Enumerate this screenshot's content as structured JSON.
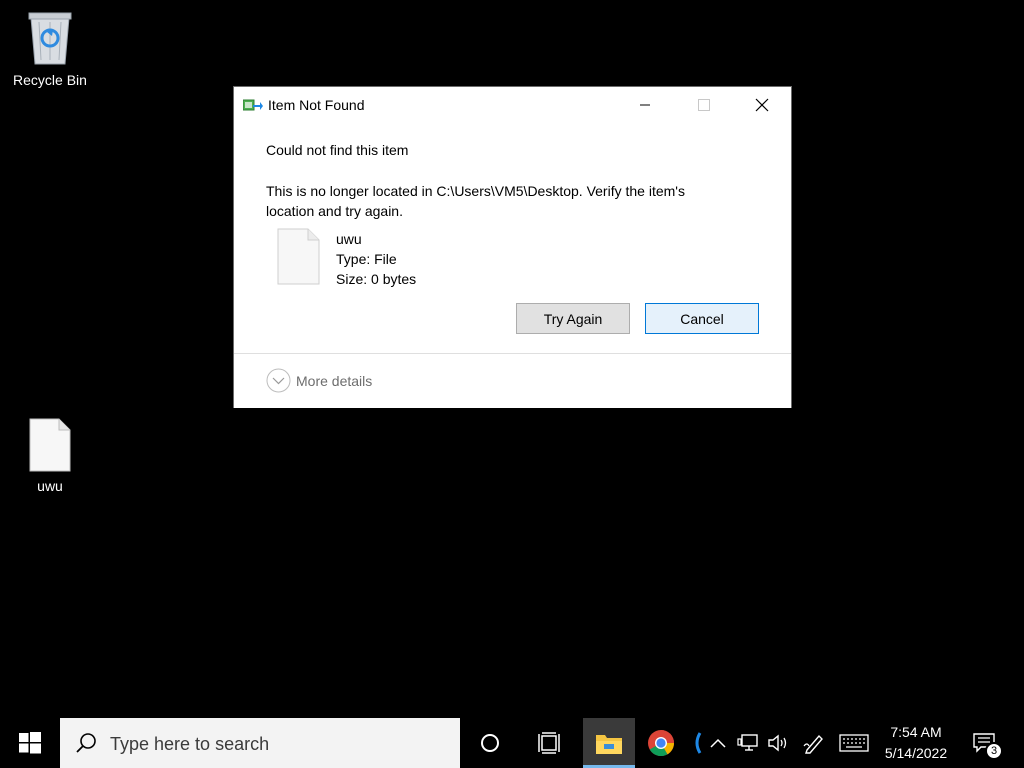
{
  "desktop": {
    "icons": [
      {
        "label": "Recycle Bin"
      },
      {
        "label": "uwu"
      }
    ]
  },
  "dialog": {
    "title": "Item Not Found",
    "heading": "Could not find this item",
    "message": "This is no longer located in C:\\Users\\VM5\\Desktop. Verify the item's location and try again.",
    "file": {
      "name": "uwu",
      "type": "Type: File",
      "size": "Size: 0 bytes"
    },
    "buttons": {
      "try_again": "Try Again",
      "cancel": "Cancel"
    },
    "more_details": "More details",
    "colors": {
      "default_button_border": "#0078d7",
      "default_button_bg": "#e5f1fb"
    }
  },
  "taskbar": {
    "search_placeholder": "Type here to search",
    "pinned": [
      "cortana-icon",
      "task-view-icon",
      "file-explorer-icon",
      "chrome-icon"
    ],
    "tray": {
      "time": "7:54 AM",
      "date": "5/14/2022",
      "notification_count": "3"
    }
  }
}
